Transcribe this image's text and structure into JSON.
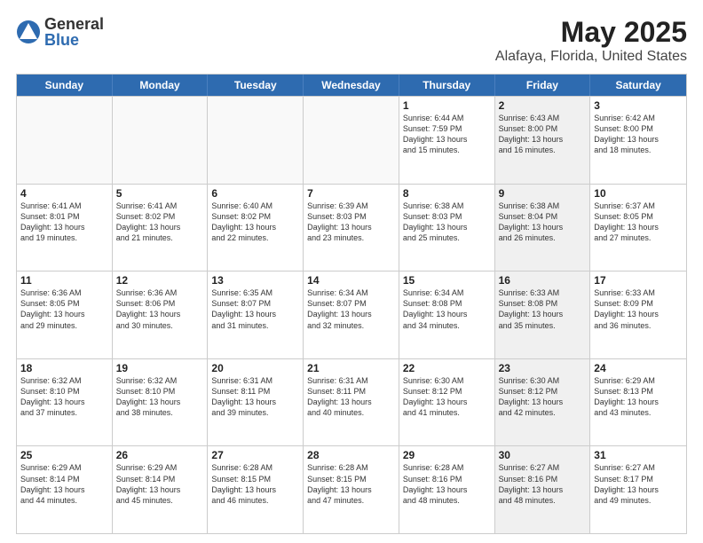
{
  "header": {
    "logo": {
      "general": "General",
      "blue": "Blue"
    },
    "title": "May 2025",
    "location": "Alafaya, Florida, United States"
  },
  "weekdays": [
    "Sunday",
    "Monday",
    "Tuesday",
    "Wednesday",
    "Thursday",
    "Friday",
    "Saturday"
  ],
  "rows": [
    [
      {
        "day": "",
        "info": "",
        "empty": true
      },
      {
        "day": "",
        "info": "",
        "empty": true
      },
      {
        "day": "",
        "info": "",
        "empty": true
      },
      {
        "day": "",
        "info": "",
        "empty": true
      },
      {
        "day": "1",
        "info": "Sunrise: 6:44 AM\nSunset: 7:59 PM\nDaylight: 13 hours\nand 15 minutes.",
        "empty": false
      },
      {
        "day": "2",
        "info": "Sunrise: 6:43 AM\nSunset: 8:00 PM\nDaylight: 13 hours\nand 16 minutes.",
        "empty": false,
        "shaded": true
      },
      {
        "day": "3",
        "info": "Sunrise: 6:42 AM\nSunset: 8:00 PM\nDaylight: 13 hours\nand 18 minutes.",
        "empty": false
      }
    ],
    [
      {
        "day": "4",
        "info": "Sunrise: 6:41 AM\nSunset: 8:01 PM\nDaylight: 13 hours\nand 19 minutes.",
        "empty": false
      },
      {
        "day": "5",
        "info": "Sunrise: 6:41 AM\nSunset: 8:02 PM\nDaylight: 13 hours\nand 21 minutes.",
        "empty": false
      },
      {
        "day": "6",
        "info": "Sunrise: 6:40 AM\nSunset: 8:02 PM\nDaylight: 13 hours\nand 22 minutes.",
        "empty": false
      },
      {
        "day": "7",
        "info": "Sunrise: 6:39 AM\nSunset: 8:03 PM\nDaylight: 13 hours\nand 23 minutes.",
        "empty": false
      },
      {
        "day": "8",
        "info": "Sunrise: 6:38 AM\nSunset: 8:03 PM\nDaylight: 13 hours\nand 25 minutes.",
        "empty": false
      },
      {
        "day": "9",
        "info": "Sunrise: 6:38 AM\nSunset: 8:04 PM\nDaylight: 13 hours\nand 26 minutes.",
        "empty": false,
        "shaded": true
      },
      {
        "day": "10",
        "info": "Sunrise: 6:37 AM\nSunset: 8:05 PM\nDaylight: 13 hours\nand 27 minutes.",
        "empty": false
      }
    ],
    [
      {
        "day": "11",
        "info": "Sunrise: 6:36 AM\nSunset: 8:05 PM\nDaylight: 13 hours\nand 29 minutes.",
        "empty": false
      },
      {
        "day": "12",
        "info": "Sunrise: 6:36 AM\nSunset: 8:06 PM\nDaylight: 13 hours\nand 30 minutes.",
        "empty": false
      },
      {
        "day": "13",
        "info": "Sunrise: 6:35 AM\nSunset: 8:07 PM\nDaylight: 13 hours\nand 31 minutes.",
        "empty": false
      },
      {
        "day": "14",
        "info": "Sunrise: 6:34 AM\nSunset: 8:07 PM\nDaylight: 13 hours\nand 32 minutes.",
        "empty": false
      },
      {
        "day": "15",
        "info": "Sunrise: 6:34 AM\nSunset: 8:08 PM\nDaylight: 13 hours\nand 34 minutes.",
        "empty": false
      },
      {
        "day": "16",
        "info": "Sunrise: 6:33 AM\nSunset: 8:08 PM\nDaylight: 13 hours\nand 35 minutes.",
        "empty": false,
        "shaded": true
      },
      {
        "day": "17",
        "info": "Sunrise: 6:33 AM\nSunset: 8:09 PM\nDaylight: 13 hours\nand 36 minutes.",
        "empty": false
      }
    ],
    [
      {
        "day": "18",
        "info": "Sunrise: 6:32 AM\nSunset: 8:10 PM\nDaylight: 13 hours\nand 37 minutes.",
        "empty": false
      },
      {
        "day": "19",
        "info": "Sunrise: 6:32 AM\nSunset: 8:10 PM\nDaylight: 13 hours\nand 38 minutes.",
        "empty": false
      },
      {
        "day": "20",
        "info": "Sunrise: 6:31 AM\nSunset: 8:11 PM\nDaylight: 13 hours\nand 39 minutes.",
        "empty": false
      },
      {
        "day": "21",
        "info": "Sunrise: 6:31 AM\nSunset: 8:11 PM\nDaylight: 13 hours\nand 40 minutes.",
        "empty": false
      },
      {
        "day": "22",
        "info": "Sunrise: 6:30 AM\nSunset: 8:12 PM\nDaylight: 13 hours\nand 41 minutes.",
        "empty": false
      },
      {
        "day": "23",
        "info": "Sunrise: 6:30 AM\nSunset: 8:12 PM\nDaylight: 13 hours\nand 42 minutes.",
        "empty": false,
        "shaded": true
      },
      {
        "day": "24",
        "info": "Sunrise: 6:29 AM\nSunset: 8:13 PM\nDaylight: 13 hours\nand 43 minutes.",
        "empty": false
      }
    ],
    [
      {
        "day": "25",
        "info": "Sunrise: 6:29 AM\nSunset: 8:14 PM\nDaylight: 13 hours\nand 44 minutes.",
        "empty": false
      },
      {
        "day": "26",
        "info": "Sunrise: 6:29 AM\nSunset: 8:14 PM\nDaylight: 13 hours\nand 45 minutes.",
        "empty": false
      },
      {
        "day": "27",
        "info": "Sunrise: 6:28 AM\nSunset: 8:15 PM\nDaylight: 13 hours\nand 46 minutes.",
        "empty": false
      },
      {
        "day": "28",
        "info": "Sunrise: 6:28 AM\nSunset: 8:15 PM\nDaylight: 13 hours\nand 47 minutes.",
        "empty": false
      },
      {
        "day": "29",
        "info": "Sunrise: 6:28 AM\nSunset: 8:16 PM\nDaylight: 13 hours\nand 48 minutes.",
        "empty": false
      },
      {
        "day": "30",
        "info": "Sunrise: 6:27 AM\nSunset: 8:16 PM\nDaylight: 13 hours\nand 48 minutes.",
        "empty": false,
        "shaded": true
      },
      {
        "day": "31",
        "info": "Sunrise: 6:27 AM\nSunset: 8:17 PM\nDaylight: 13 hours\nand 49 minutes.",
        "empty": false
      }
    ]
  ]
}
